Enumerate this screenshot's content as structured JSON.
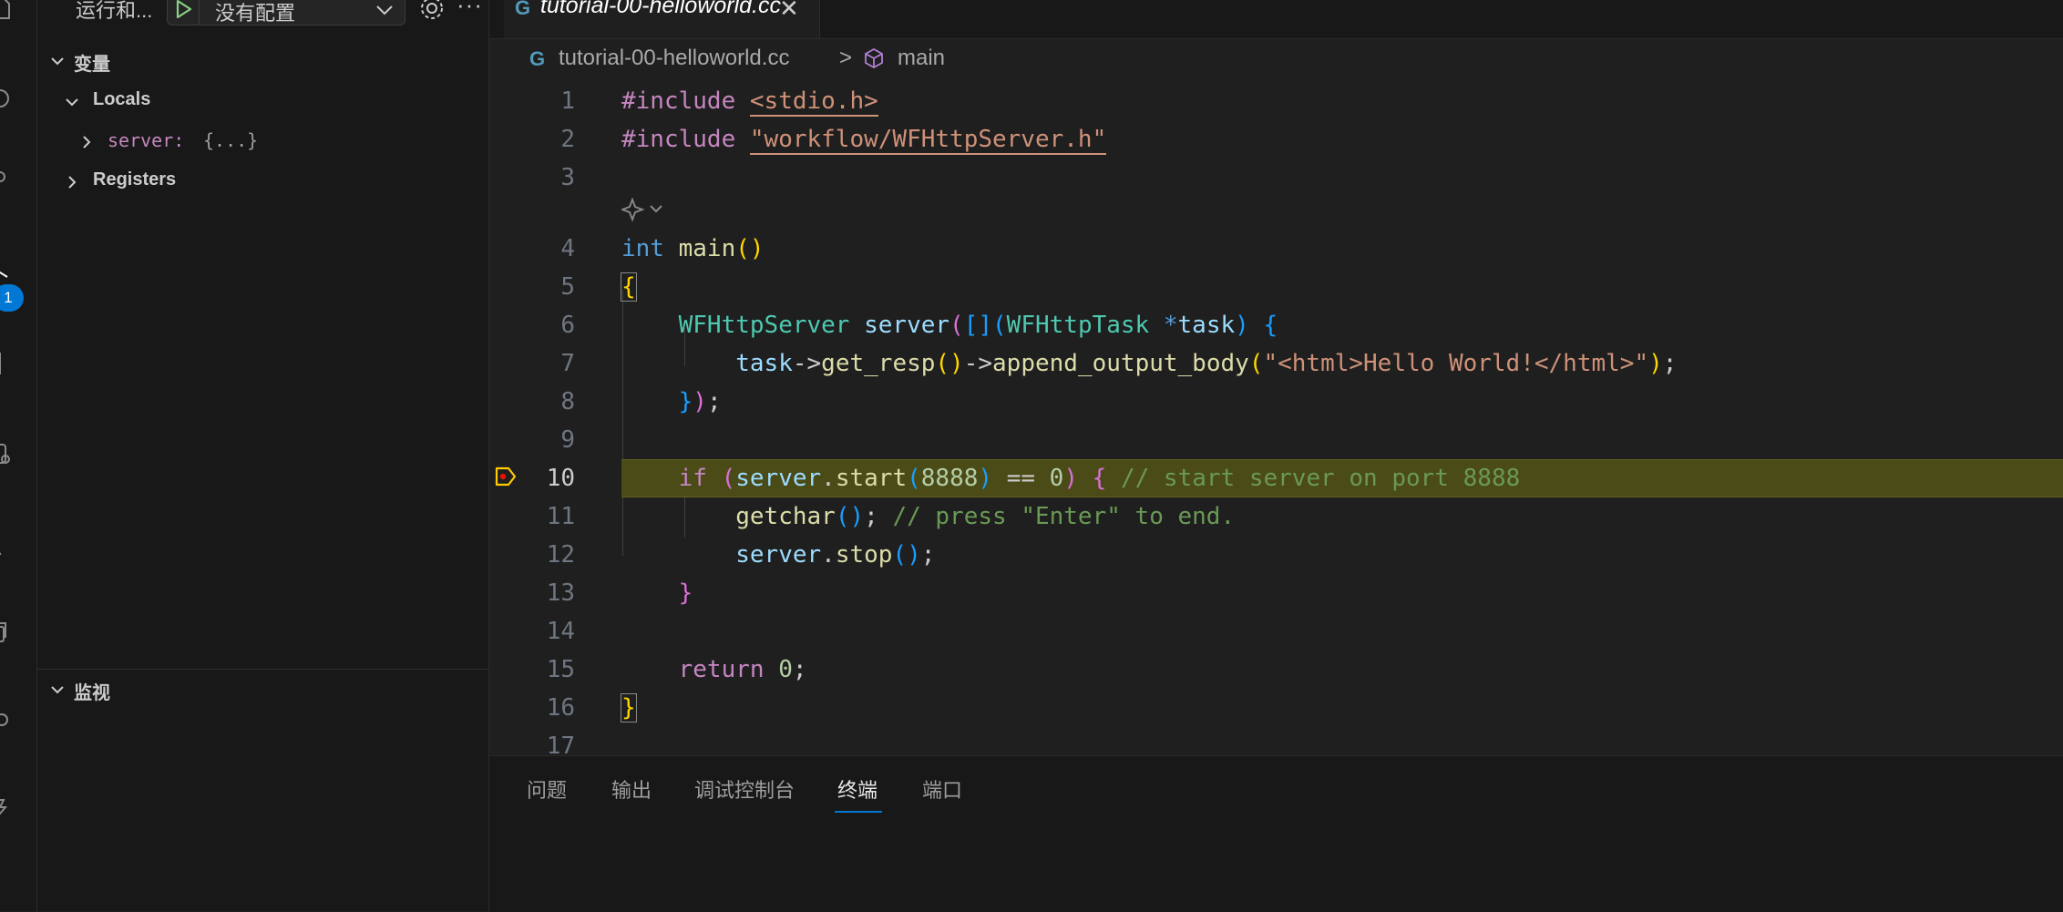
{
  "run_toolbar": {
    "title": "运行和...",
    "config_label": "没有配置"
  },
  "activity": {
    "run_badge": "1"
  },
  "variables": {
    "header": "变量",
    "locals_label": "Locals",
    "server_name": "server:",
    "server_value": "{...}",
    "registers_label": "Registers"
  },
  "watch": {
    "header": "监视"
  },
  "editor": {
    "tab_label": "tutorial-00-helloworld.cc",
    "tab_icon": "G",
    "breadcrumb_file": "tutorial-00-helloworld.cc",
    "breadcrumb_sep": ">",
    "breadcrumb_symbol": "main",
    "line_numbers": [
      "1",
      "2",
      "3",
      "4",
      "5",
      "6",
      "7",
      "8",
      "9",
      "10",
      "11",
      "12",
      "13",
      "14",
      "15",
      "16",
      "17"
    ],
    "code": {
      "l1_kw": "#include",
      "l1_hdr": "<stdio.h>",
      "l2_kw": "#include",
      "l2_hdr": "\"workflow/WFHttpServer.h\"",
      "l4_type": "int",
      "l4_fn": "main",
      "l6_type": "WFHttpServer",
      "l6_var": "server",
      "l6_type2": "WFHttpTask",
      "l6_param": "task",
      "l7_var": "task",
      "l7_fn1": "get_resp",
      "l7_fn2": "append_output_body",
      "l7_str": "\"<html>Hello World!</html>\"",
      "l10_kw": "if",
      "l10_var": "server",
      "l10_fn": "start",
      "l10_num1": "8888",
      "l10_num2": "0",
      "l10_cmt": "// start server on port 8888",
      "l11_fn": "getchar",
      "l11_cmt": "// press \"Enter\" to end.",
      "l12_var": "server",
      "l12_fn": "stop",
      "l15_kw": "return",
      "l15_num": "0"
    }
  },
  "panel": {
    "tabs": [
      "问题",
      "输出",
      "调试控制台",
      "终端",
      "端口"
    ],
    "active_tab": "终端"
  },
  "colors": {
    "accent": "#0078d4",
    "highlight_line": "#4b4b18",
    "breakpoint": "#ffcc00"
  }
}
